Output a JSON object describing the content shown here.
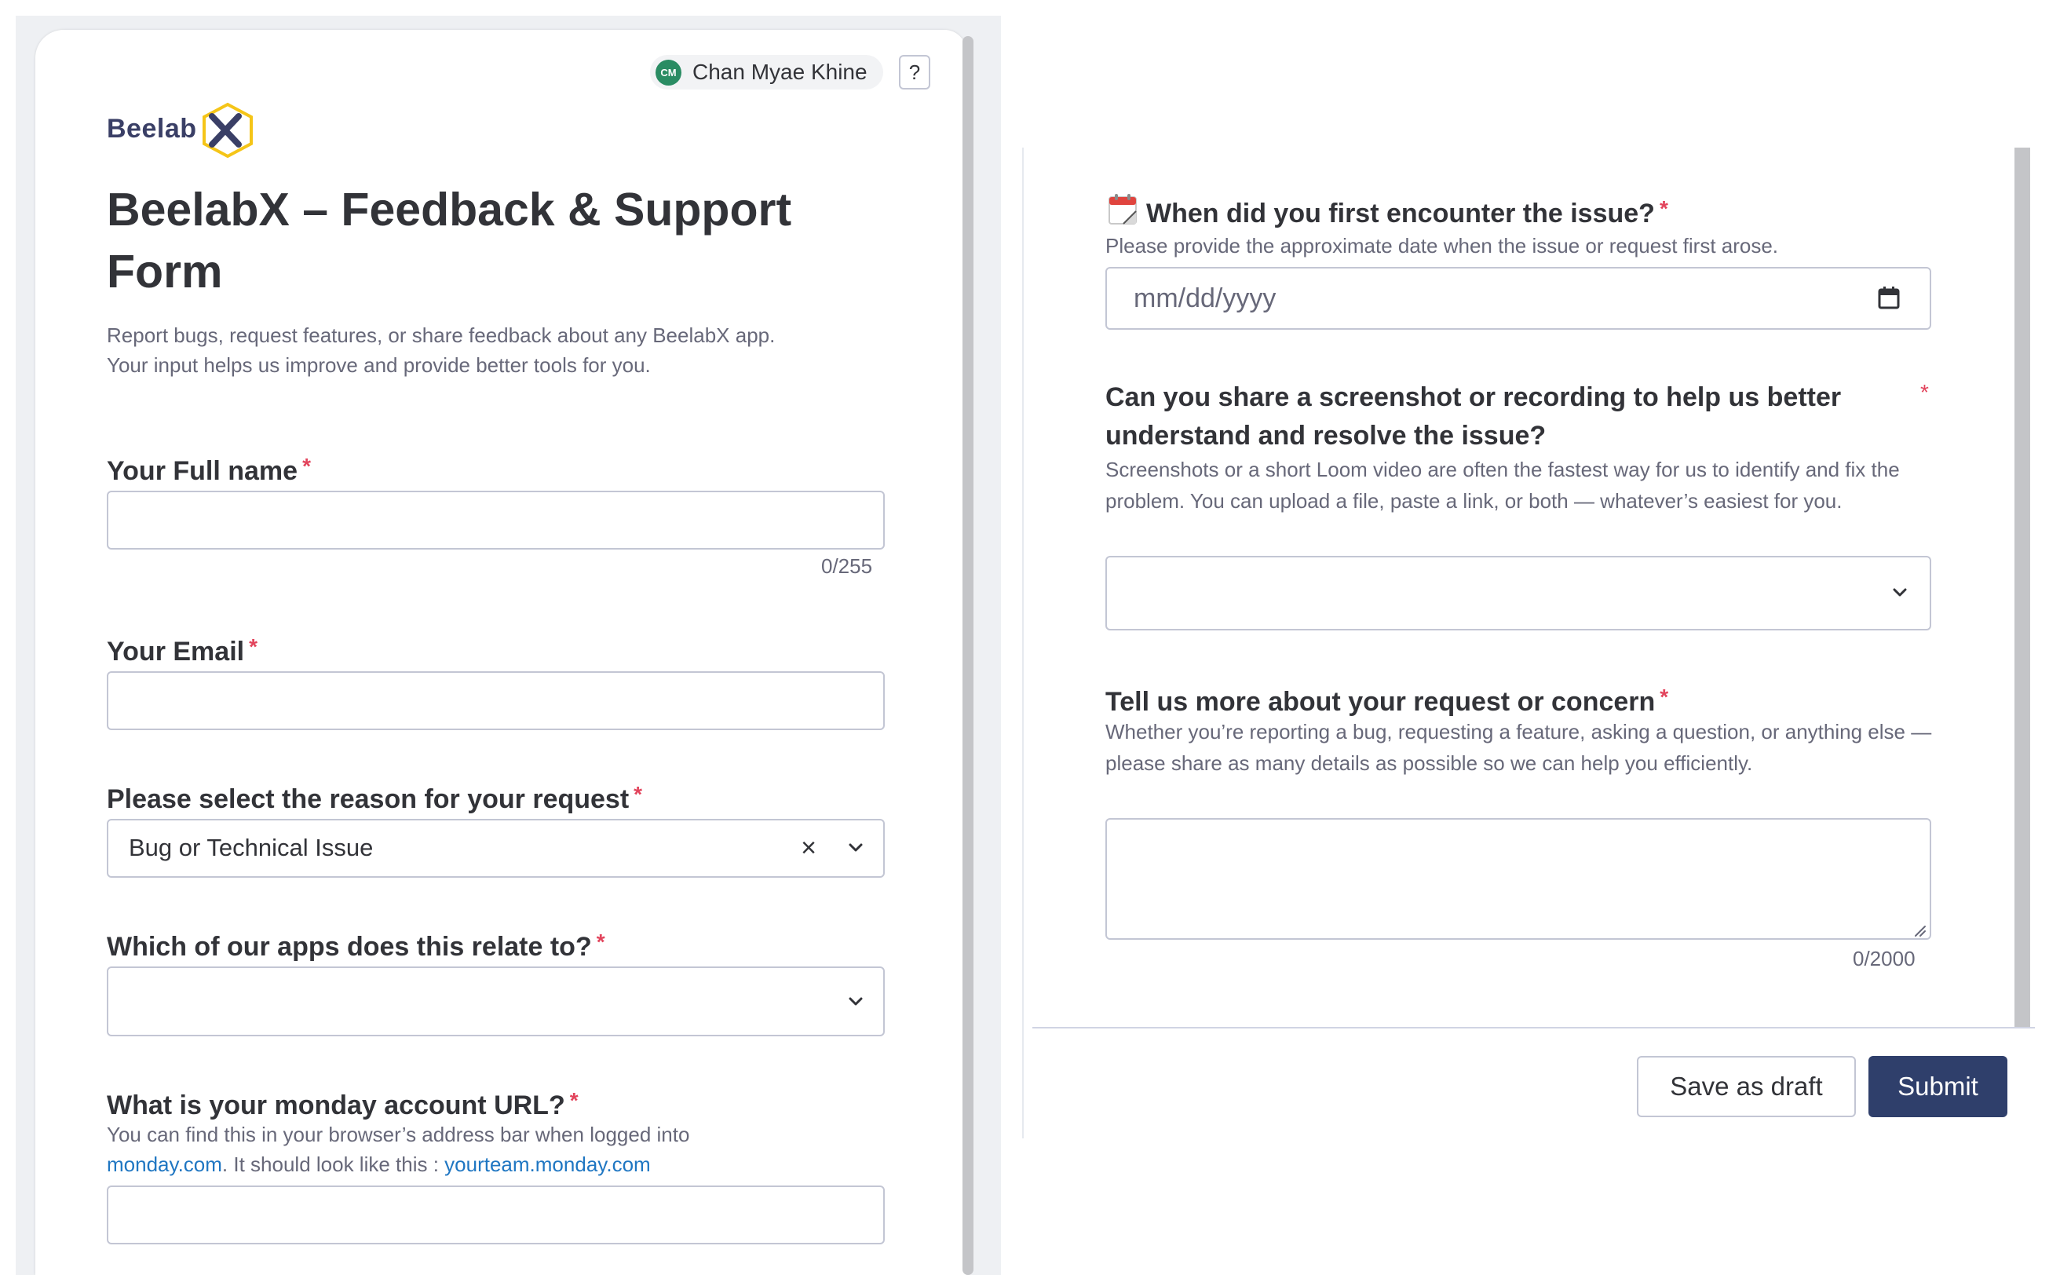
{
  "user": {
    "initials": "CM",
    "name": "Chan Myae Khine"
  },
  "help_button": "?",
  "logo": {
    "text": "Beelab"
  },
  "form": {
    "title": "BeelabX – Feedback & Support Form",
    "description_line1": "Report bugs, request features, or share feedback about any BeelabX app.",
    "description_line2": "Your input helps us improve and provide better tools for you."
  },
  "required_mark": "*",
  "fields": {
    "full_name": {
      "label": "Your Full name",
      "value": "",
      "counter": "0/255"
    },
    "email": {
      "label": "Your Email",
      "value": ""
    },
    "reason": {
      "label": "Please select the reason for your request",
      "selected": "Bug or Technical Issue"
    },
    "apps": {
      "label": "Which of our apps does this relate to?",
      "selected": ""
    },
    "monday_url": {
      "label": "What is your monday account URL?",
      "help_line1": "You can find this in your browser’s address bar when logged into",
      "help_link1": "monday.com",
      "help_mid": ". It should look like this : ",
      "help_link2": "yourteam.monday.com",
      "value": ""
    },
    "first_encounter": {
      "label": "When did you first encounter the issue?",
      "help": "Please provide the approximate date when the issue or request first arose.",
      "placeholder": "mm/dd/yyyy"
    },
    "screenshot": {
      "label": "Can you share a screenshot or recording to help us better understand and resolve the issue?",
      "help": "Screenshots or a short Loom video are often the fastest way for us to identify and fix the problem. You can upload a file, paste a link, or both — whatever’s easiest for you.",
      "selected": ""
    },
    "details": {
      "label": "Tell us more about your request or concern",
      "help": "Whether you’re reporting a bug, requesting a feature, asking a question, or anything else — please share as many details as possible so we can help you efficiently.",
      "value": "",
      "counter": "0/2000"
    }
  },
  "buttons": {
    "save_draft": "Save as draft",
    "submit": "Submit"
  },
  "colors": {
    "brand_navy": "#2f3f6b",
    "required_red": "#e2445c",
    "link_blue": "#1f76c2",
    "avatar_green": "#2a8c63",
    "logo_hex_yellow": "#f5c518"
  },
  "icons": {
    "clear": "close-icon",
    "chevron": "chevron-down-icon",
    "calendar": "calendar-icon"
  }
}
